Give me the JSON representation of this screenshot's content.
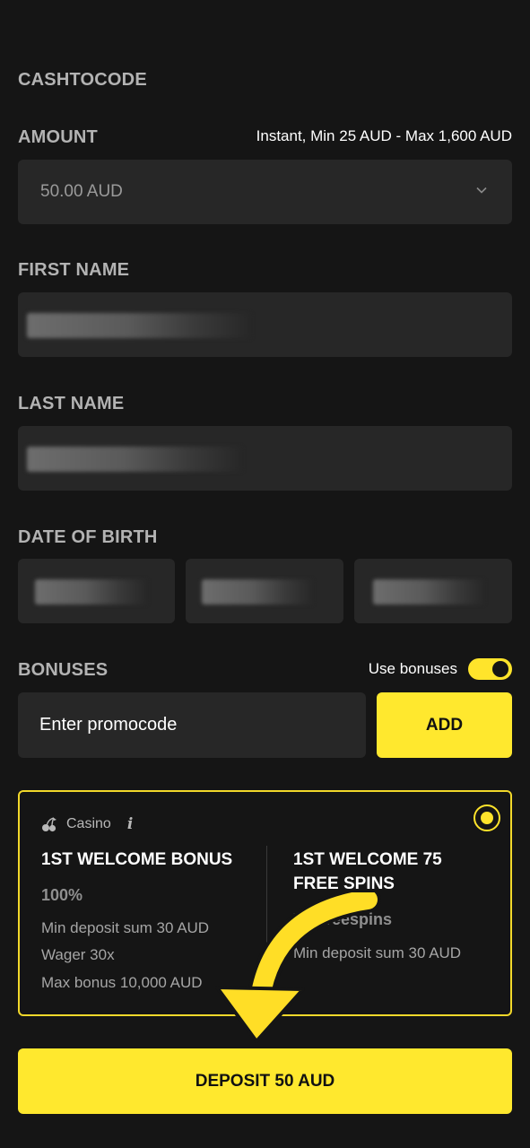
{
  "method": {
    "title": "CASHTOCODE"
  },
  "amount": {
    "label": "AMOUNT",
    "hint": "Instant, Min 25 AUD - Max 1,600 AUD",
    "value": "50.00 AUD"
  },
  "first_name": {
    "label": "FIRST NAME"
  },
  "last_name": {
    "label": "LAST NAME"
  },
  "dob": {
    "label": "DATE OF BIRTH"
  },
  "bonuses": {
    "label": "BONUSES",
    "toggle_label": "Use bonuses",
    "toggle_on": true,
    "promo_placeholder": "Enter promocode",
    "add_label": "ADD"
  },
  "bonus_card": {
    "category": "Casino",
    "info_glyph": "i",
    "offers": [
      {
        "title": "1ST WELCOME BONUS",
        "subtitle": "100%",
        "lines": [
          "Min deposit sum 30 AUD",
          "Wager 30x",
          "Max bonus 10,000 AUD"
        ]
      },
      {
        "title_line1": "1ST WELCOME 75",
        "title_line2": "FREE SPINS",
        "subtitle": "75 Freespins",
        "lines": [
          "Min deposit sum 30 AUD"
        ]
      }
    ]
  },
  "deposit": {
    "label": "DEPOSIT 50 AUD"
  },
  "colors": {
    "background": "#151515",
    "field": "#272727",
    "accent": "#ffe82e",
    "label": "#b3b3b3"
  },
  "icons": [
    "chevron-down-icon",
    "cherry-icon",
    "info-icon",
    "radio-selected-icon",
    "arrow-annotation"
  ]
}
